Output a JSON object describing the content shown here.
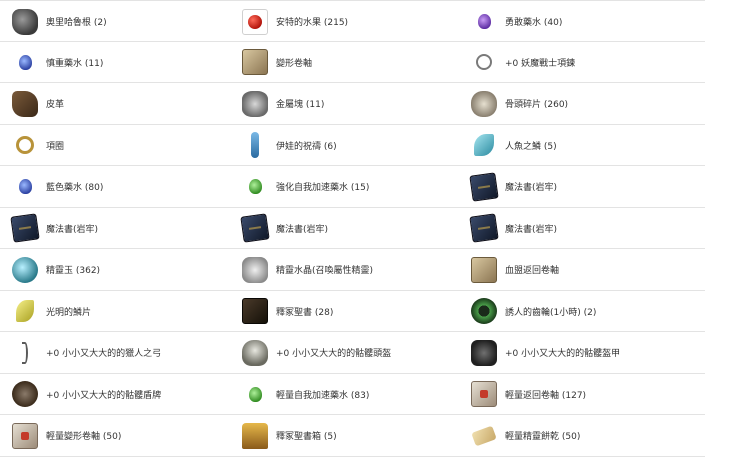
{
  "rows": [
    [
      {
        "icon": "ore-icon",
        "label": "奧里哈魯根 (2)"
      },
      {
        "icon": "apple-icon",
        "label": "安特的水果 (215)"
      },
      {
        "icon": "purple-potion-icon",
        "label": "勇敢藥水 (40)"
      }
    ],
    [
      {
        "icon": "blue-potion-icon",
        "label": "慎重藥水 (11)"
      },
      {
        "icon": "scroll-icon",
        "label": "變形卷軸"
      },
      {
        "icon": "necklace-icon",
        "label": "+0 妖魔戰士項鍊"
      }
    ],
    [
      {
        "icon": "leather-icon",
        "label": "皮革"
      },
      {
        "icon": "metal-ingot-icon",
        "label": "金屬塊 (11)"
      },
      {
        "icon": "bone-fragment-icon",
        "label": "骨頭碎片 (260)"
      }
    ],
    [
      {
        "icon": "collar-icon",
        "label": "項圈"
      },
      {
        "icon": "blessing-icon",
        "label": "伊娃的祝禱 (6)"
      },
      {
        "icon": "mermaid-scale-icon",
        "label": "人魚之鱗 (5)"
      }
    ],
    [
      {
        "icon": "blue-potion-icon",
        "label": "藍色藥水 (80)"
      },
      {
        "icon": "green-potion-icon",
        "label": "強化自我加速藥水 (15)"
      },
      {
        "icon": "spellbook-icon",
        "label": "魔法書(岩牢)"
      }
    ],
    [
      {
        "icon": "spellbook-icon",
        "label": "魔法書(岩牢)"
      },
      {
        "icon": "spellbook-icon",
        "label": "魔法書(岩牢)"
      },
      {
        "icon": "spellbook-icon",
        "label": "魔法書(岩牢)"
      }
    ],
    [
      {
        "icon": "spirit-gem-icon",
        "label": "精靈玉 (362)"
      },
      {
        "icon": "spirit-crystal-icon",
        "label": "精靈水晶(召喚屬性精靈)"
      },
      {
        "icon": "blood-pledge-scroll-icon",
        "label": "血盟返回卷軸"
      }
    ],
    [
      {
        "icon": "light-scale-icon",
        "label": "光明的鱗片"
      },
      {
        "icon": "dark-book-icon",
        "label": "釋冢聖書 (28)"
      },
      {
        "icon": "gear-icon",
        "label": "誘人的齒輪(1小時) (2)"
      }
    ],
    [
      {
        "icon": "bow-icon",
        "label": "+0 小小又大大的的獵人之弓"
      },
      {
        "icon": "skull-helmet-icon",
        "label": "+0 小小又大大的的骷髏頭盔"
      },
      {
        "icon": "skull-armor-icon",
        "label": "+0 小小又大大的的骷髏盔甲"
      }
    ],
    [
      {
        "icon": "skull-shield-icon",
        "label": "+0 小小又大大的的骷髏盾牌"
      },
      {
        "icon": "green-potion-icon",
        "label": "輕量自我加速藥水 (83)"
      },
      {
        "icon": "return-scroll-icon",
        "label": "輕量返回卷軸 (127)"
      }
    ],
    [
      {
        "icon": "polymorph-scroll-icon",
        "label": "輕量變形卷軸 (50)"
      },
      {
        "icon": "treasure-chest-icon",
        "label": "釋冢聖書箱 (5)"
      },
      {
        "icon": "elven-wafer-icon",
        "label": "輕量精靈餅乾 (50)"
      }
    ]
  ]
}
